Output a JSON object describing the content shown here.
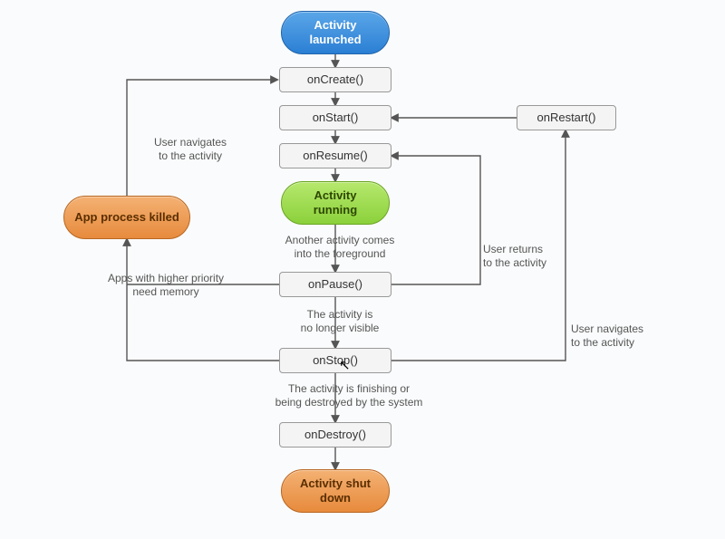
{
  "nodes": {
    "launched": "Activity\nlaunched",
    "oncreate": "onCreate()",
    "onstart": "onStart()",
    "onresume": "onResume()",
    "running": "Activity\nrunning",
    "onpause": "onPause()",
    "onstop": "onStop()",
    "ondestroy": "onDestroy()",
    "shutdown": "Activity\nshut down",
    "killed": "App process\nkilled",
    "onrestart": "onRestart()"
  },
  "labels": {
    "nav_activity": "User navigates\nto the activity",
    "another_fg": "Another activity comes\ninto the foreground",
    "user_returns": "User returns\nto the activity",
    "no_longer": "The activity is\nno longer visible",
    "higher_priority": "Apps with higher priority\nneed memory",
    "nav_activity2": "User navigates\nto the activity",
    "finishing": "The activity is finishing or\nbeing destroyed by the system"
  }
}
